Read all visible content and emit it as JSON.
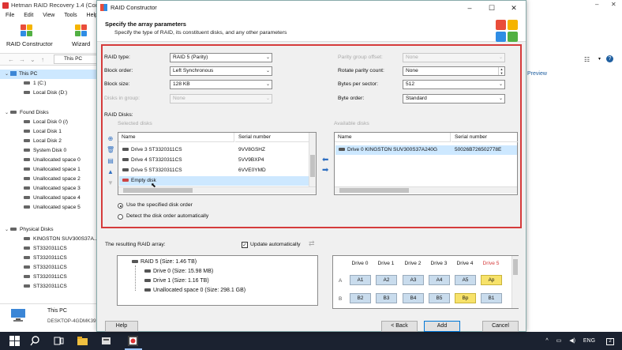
{
  "background_app": {
    "title": "Hetman RAID Recovery 1.4 (Comm",
    "menu": [
      "File",
      "Edit",
      "View",
      "Tools",
      "Help"
    ],
    "toolbar": {
      "raid_constructor": "RAID Constructor",
      "wizard": "Wizard"
    },
    "address": "This PC",
    "preview_label": "Preview",
    "tree": {
      "this_pc": "This PC",
      "this_pc_items": [
        "1 (C:)",
        "Local Disk (D:)"
      ],
      "found_disks": "Found Disks",
      "found_disks_items": [
        "Local Disk 0 (/)",
        "Local Disk 1",
        "Local Disk 2",
        "System Disk 0",
        "Unallocated space 0",
        "Unallocated space 1",
        "Unallocated space 2",
        "Unallocated space 3",
        "Unallocated space 4",
        "Unallocated space 5"
      ],
      "physical_disks": "Physical Disks",
      "physical_disks_items": [
        "KINGSTON SUV300S37A...",
        "ST3320311CS",
        "ST3320311CS",
        "ST3320311CS",
        "ST3320311CS",
        "ST3320311CS"
      ]
    },
    "footer": {
      "name": "This PC",
      "sub": "DESKTOP-4GDMK39"
    }
  },
  "dialog": {
    "title": "RAID Constructor",
    "heading": "Specify the array parameters",
    "subheading": "Specify the type of RAID, its constituent disks, and any other parameters",
    "params_left": [
      {
        "label": "RAID type:",
        "value": "RAID 5 (Parity)",
        "enabled": true
      },
      {
        "label": "Block order:",
        "value": "Left Synchronous",
        "enabled": true
      },
      {
        "label": "Block size:",
        "value": "128 KB",
        "enabled": true
      },
      {
        "label": "Disks in group:",
        "value": "None",
        "enabled": false
      }
    ],
    "params_right": [
      {
        "label": "Parity group offset:",
        "value": "None",
        "enabled": false
      },
      {
        "label": "Rotate parity count:",
        "value": "None",
        "enabled": true
      },
      {
        "label": "Bytes per sector:",
        "value": "512",
        "enabled": true
      },
      {
        "label": "Byte order:",
        "value": "Standard",
        "enabled": true
      }
    ],
    "raid_disks_label": "RAID Disks:",
    "selected_disks_label": "Selected disks",
    "available_disks_label": "Available disks",
    "col_name": "Name",
    "col_serial": "Serial number",
    "selected_disks": [
      {
        "name": "Drive 3 ST3320311CS",
        "serial": "9VV8GSHZ"
      },
      {
        "name": "Drive 4 ST3320311CS",
        "serial": "5VV9BXP4"
      },
      {
        "name": "Drive 5 ST3320311CS",
        "serial": "6VVE0YMD"
      },
      {
        "name": "Empty disk",
        "serial": ""
      }
    ],
    "available_disks": [
      {
        "name": "Drive 0 KINGSTON SUV300S37A240G",
        "serial": "50026B726502778E"
      }
    ],
    "order_options": [
      "Use the specified disk order",
      "Detect the disk order automatically"
    ],
    "result_label": "The resulting RAID array:",
    "update_auto": "Update automatically",
    "result_tree": [
      "RAID 5 (Size: 1.46 TB)",
      "Drive 0 (Size: 15.98 MB)",
      "Drive 1 (Size: 1.16 TB)",
      "Unallocated space 0 (Size: 298.1 GB)"
    ],
    "grid_headers": [
      "Drive 0",
      "Drive 1",
      "Drive 2",
      "Drive 3",
      "Drive 4",
      "Drive 5"
    ],
    "grid_row_labels": [
      "A",
      "B"
    ],
    "grid_rows": [
      [
        "A1",
        "A2",
        "A3",
        "A4",
        "A5",
        "Ap"
      ],
      [
        "B2",
        "B3",
        "B4",
        "B5",
        "Bp",
        "B1"
      ]
    ],
    "buttons": {
      "help": "Help",
      "back": "< Back",
      "add": "Add",
      "cancel": "Cancel"
    }
  },
  "taskbar": {
    "lang": "ENG",
    "notif": "2"
  },
  "colors": {
    "accent_red": "#d53b3b",
    "cell_blue": "#c9dced",
    "cell_yellow": "#f7e26a",
    "drive5_red": "#d53b3b"
  }
}
